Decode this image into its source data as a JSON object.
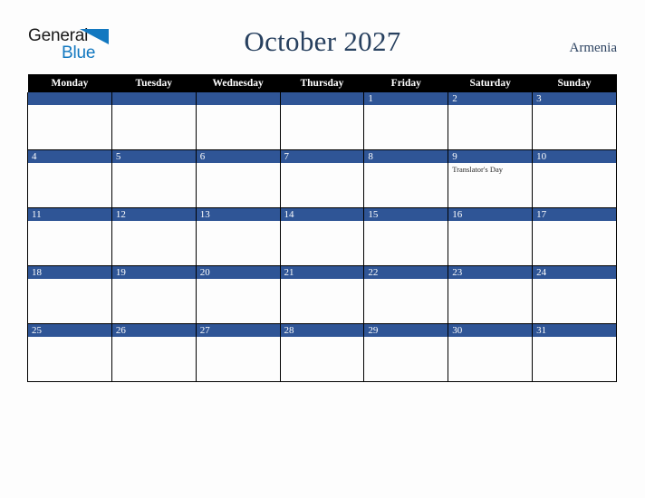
{
  "logo": {
    "word1": "General",
    "word2": "Blue",
    "triangle_color": "#1278c0",
    "text_color": "#1a1a1a"
  },
  "header": {
    "title": "October 2027",
    "country": "Armenia",
    "title_color": "#27405f"
  },
  "calendar": {
    "weekday_headers": [
      "Monday",
      "Tuesday",
      "Wednesday",
      "Thursday",
      "Friday",
      "Saturday",
      "Sunday"
    ],
    "accent_color": "#2f5596",
    "header_bg": "#000000",
    "weeks": [
      [
        {
          "day": "",
          "event": ""
        },
        {
          "day": "",
          "event": ""
        },
        {
          "day": "",
          "event": ""
        },
        {
          "day": "",
          "event": ""
        },
        {
          "day": "1",
          "event": ""
        },
        {
          "day": "2",
          "event": ""
        },
        {
          "day": "3",
          "event": ""
        }
      ],
      [
        {
          "day": "4",
          "event": ""
        },
        {
          "day": "5",
          "event": ""
        },
        {
          "day": "6",
          "event": ""
        },
        {
          "day": "7",
          "event": ""
        },
        {
          "day": "8",
          "event": ""
        },
        {
          "day": "9",
          "event": "Translator's Day"
        },
        {
          "day": "10",
          "event": ""
        }
      ],
      [
        {
          "day": "11",
          "event": ""
        },
        {
          "day": "12",
          "event": ""
        },
        {
          "day": "13",
          "event": ""
        },
        {
          "day": "14",
          "event": ""
        },
        {
          "day": "15",
          "event": ""
        },
        {
          "day": "16",
          "event": ""
        },
        {
          "day": "17",
          "event": ""
        }
      ],
      [
        {
          "day": "18",
          "event": ""
        },
        {
          "day": "19",
          "event": ""
        },
        {
          "day": "20",
          "event": ""
        },
        {
          "day": "21",
          "event": ""
        },
        {
          "day": "22",
          "event": ""
        },
        {
          "day": "23",
          "event": ""
        },
        {
          "day": "24",
          "event": ""
        }
      ],
      [
        {
          "day": "25",
          "event": ""
        },
        {
          "day": "26",
          "event": ""
        },
        {
          "day": "27",
          "event": ""
        },
        {
          "day": "28",
          "event": ""
        },
        {
          "day": "29",
          "event": ""
        },
        {
          "day": "30",
          "event": ""
        },
        {
          "day": "31",
          "event": ""
        }
      ]
    ]
  }
}
